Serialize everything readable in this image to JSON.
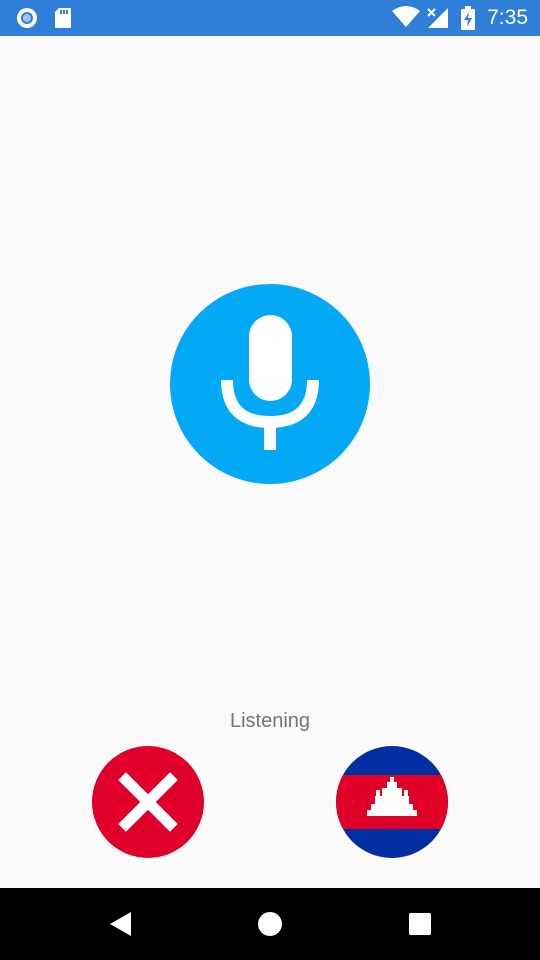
{
  "status_bar": {
    "time": "7:35",
    "icons": [
      "notification-ring-icon",
      "sd-card-icon",
      "wifi-icon",
      "no-signal-icon",
      "battery-charging-icon"
    ]
  },
  "main": {
    "mic_icon": "microphone-icon",
    "status_text": "Listening"
  },
  "actions": {
    "cancel_icon": "close-icon",
    "language_flag": "cambodia-flag-icon"
  },
  "nav_bar": {
    "buttons": [
      "back-icon",
      "home-icon",
      "recents-icon"
    ]
  },
  "colors": {
    "status_bar": "#2f7fd8",
    "mic_accent": "#03a9f4",
    "cancel_red": "#e0002a",
    "flag_blue": "#032ea1",
    "flag_red": "#e00025",
    "background": "#fafafa"
  }
}
